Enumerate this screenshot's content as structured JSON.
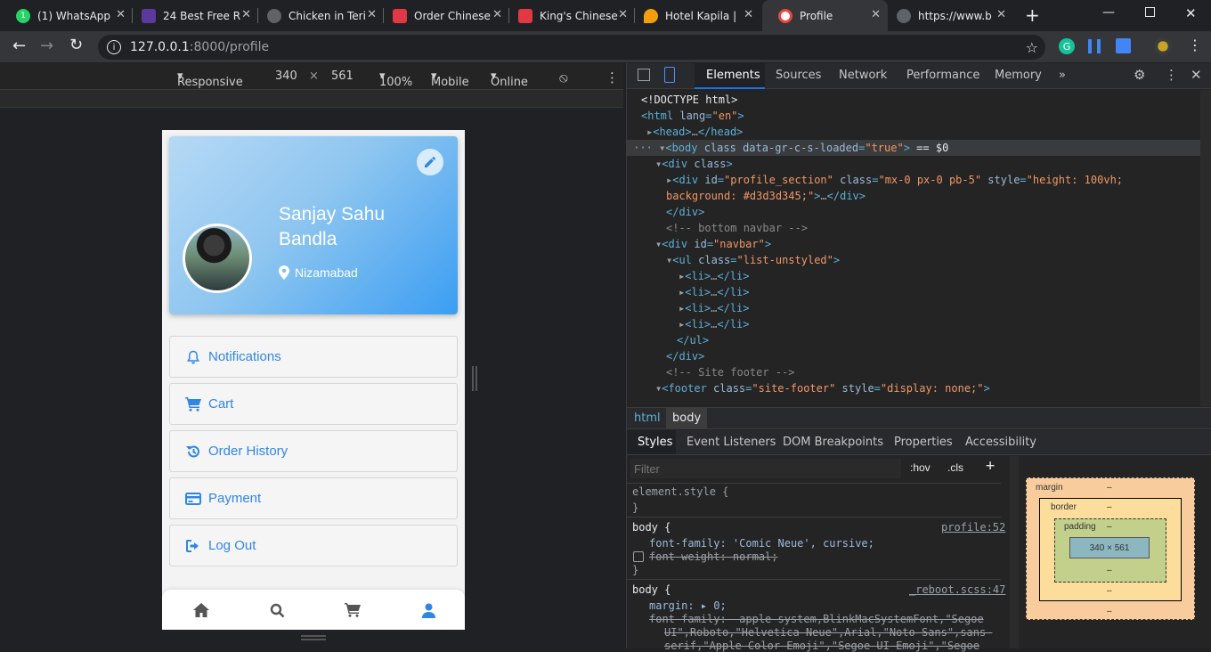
{
  "browser": {
    "tabs": [
      {
        "title": "(1) WhatsApp",
        "favicon_color": "#25d366"
      },
      {
        "title": "24 Best Free R",
        "favicon_color": "#5b3a9e"
      },
      {
        "title": "Chicken in Teri",
        "favicon_color": "#5f6368"
      },
      {
        "title": "Order Chinese",
        "favicon_color": "#e23744"
      },
      {
        "title": "King's Chinese",
        "favicon_color": "#e23744"
      },
      {
        "title": "Hotel Kapila | ",
        "favicon_color": "#f59e0b"
      },
      {
        "title": "Profile",
        "favicon_color": "#e8453c"
      },
      {
        "title": "https://www.b",
        "favicon_color": "#5f6368"
      }
    ],
    "url_host": "127.0.0.1",
    "url_rest": ":8000/profile"
  },
  "device_toolbar": {
    "mode": "Responsive",
    "width": "340",
    "times": "×",
    "height": "561",
    "zoom": "100%",
    "device": "Mobile",
    "network": "Online"
  },
  "profile": {
    "name": "Sanjay Sahu Bandla",
    "location": "Nizamabad",
    "menu": [
      {
        "label": "Notifications",
        "icon": "bell-icon"
      },
      {
        "label": "Cart",
        "icon": "cart-icon"
      },
      {
        "label": "Order History",
        "icon": "history-icon"
      },
      {
        "label": "Payment",
        "icon": "credit-card-icon"
      },
      {
        "label": "Log Out",
        "icon": "logout-icon"
      }
    ],
    "accent_color": "#2f86e6"
  },
  "devtools": {
    "tabs": [
      "Elements",
      "Sources",
      "Network",
      "Performance",
      "Memory"
    ],
    "breadcrumbs": [
      "html",
      "body"
    ],
    "subtabs": [
      "Styles",
      "Event Listeners",
      "DOM Breakpoints",
      "Properties",
      "Accessibility"
    ],
    "filter_placeholder": "Filter",
    "hov": ":hov",
    "cls": ".cls",
    "styles": {
      "rule0": "element.style {",
      "close": "}",
      "rule1_selector": "body {",
      "rule1_source": "profile:52",
      "rule1_prop1": "font-family: 'Comic Neue', cursive;",
      "rule1_prop2": "font-weight: normal;",
      "rule2_selector": "body {",
      "rule2_source": "_reboot.scss:47",
      "rule2_prop1": "margin: ▸ 0;",
      "rule2_prop2": "font-family: -apple-system,BlinkMacSystemFont,\"Segoe",
      "rule2_prop3": "UI\",Roboto,\"Helvetica Neue\",Arial,\"Noto Sans\",sans-",
      "rule2_prop4": "serif,\"Apple Color Emoji\",\"Segoe UI Emoji\",\"Segoe"
    },
    "box_model": {
      "margin": "margin",
      "border": "border",
      "padding": "padding",
      "dash": "–",
      "content": "340 × 561"
    }
  }
}
